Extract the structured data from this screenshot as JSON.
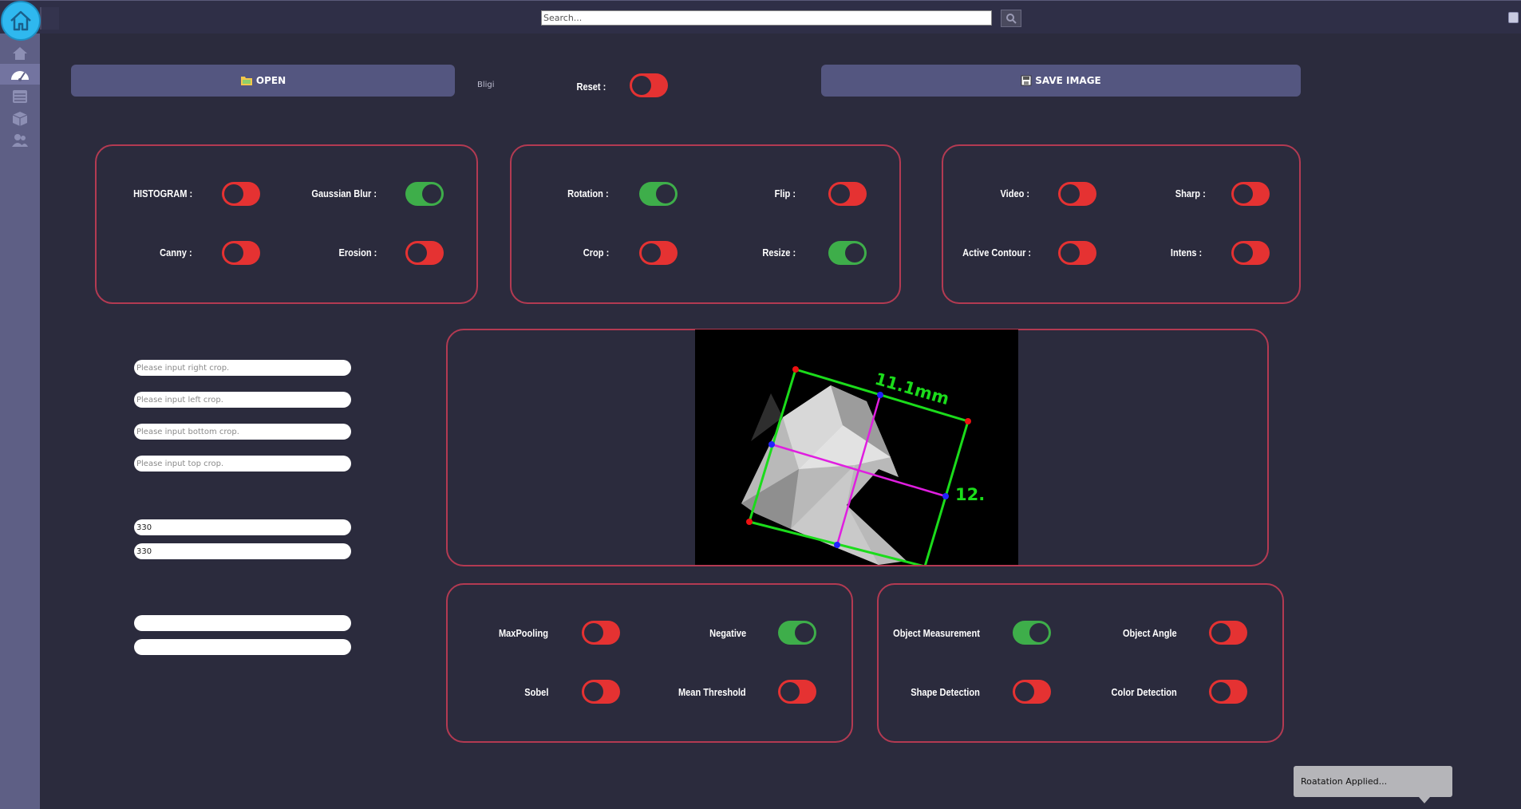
{
  "topbar": {
    "search_placeholder": "Search..."
  },
  "sidebar": {
    "items": [
      {
        "icon": "home-icon"
      },
      {
        "icon": "speedometer-icon"
      },
      {
        "icon": "list-icon"
      },
      {
        "icon": "box-icon"
      },
      {
        "icon": "users-icon"
      }
    ]
  },
  "toolbar": {
    "open_label": "OPEN",
    "save_label": "SAVE IMAGE",
    "filename_text": "Bligi",
    "reset_label": "Reset :",
    "reset_state": false
  },
  "panel1": {
    "histogram_label": "HISTOGRAM :",
    "histogram_on": false,
    "gaussian_label": "Gaussian Blur :",
    "gaussian_on": true,
    "canny_label": "Canny :",
    "canny_on": false,
    "erosion_label": "Erosion :",
    "erosion_on": false
  },
  "panel2": {
    "rotation_label": "Rotation :",
    "rotation_on": true,
    "flip_label": "Flip :",
    "flip_on": false,
    "crop_label": "Crop :",
    "crop_on": false,
    "resize_label": "Resize :",
    "resize_on": true
  },
  "panel3": {
    "video_label": "Video :",
    "video_on": false,
    "sharp_label": "Sharp :",
    "sharp_on": false,
    "active_contour_label": "Active Contour :",
    "active_contour_on": false,
    "intens_label": "Intens :",
    "intens_on": false
  },
  "crop_fields": {
    "right_placeholder": "Please input right crop.",
    "left_placeholder": "Please input left crop.",
    "bottom_placeholder": "Please input bottom crop.",
    "top_placeholder": "Please input top crop."
  },
  "resize_fields": {
    "width_value": "330",
    "height_value": "330"
  },
  "image": {
    "measure_width_label": "11.1mm",
    "measure_height_label": "12."
  },
  "panel4": {
    "maxpooling_label": "MaxPooling",
    "maxpooling_on": false,
    "negative_label": "Negative",
    "negative_on": true,
    "sobel_label": "Sobel",
    "sobel_on": false,
    "mean_threshold_label": "Mean Threshold",
    "mean_threshold_on": false
  },
  "panel5": {
    "object_measurement_label": "Object Measurement",
    "object_measurement_on": true,
    "object_angle_label": "Object Angle",
    "object_angle_on": false,
    "shape_detection_label": "Shape Detection",
    "shape_detection_on": false,
    "color_detection_label": "Color Detection",
    "color_detection_on": false
  },
  "toast": {
    "message": "Roatation Applied..."
  },
  "colors": {
    "toggle_on": "#3eae4a",
    "toggle_off": "#e53232",
    "panel_border": "#b33a52",
    "accent": "#2fb8ef"
  }
}
